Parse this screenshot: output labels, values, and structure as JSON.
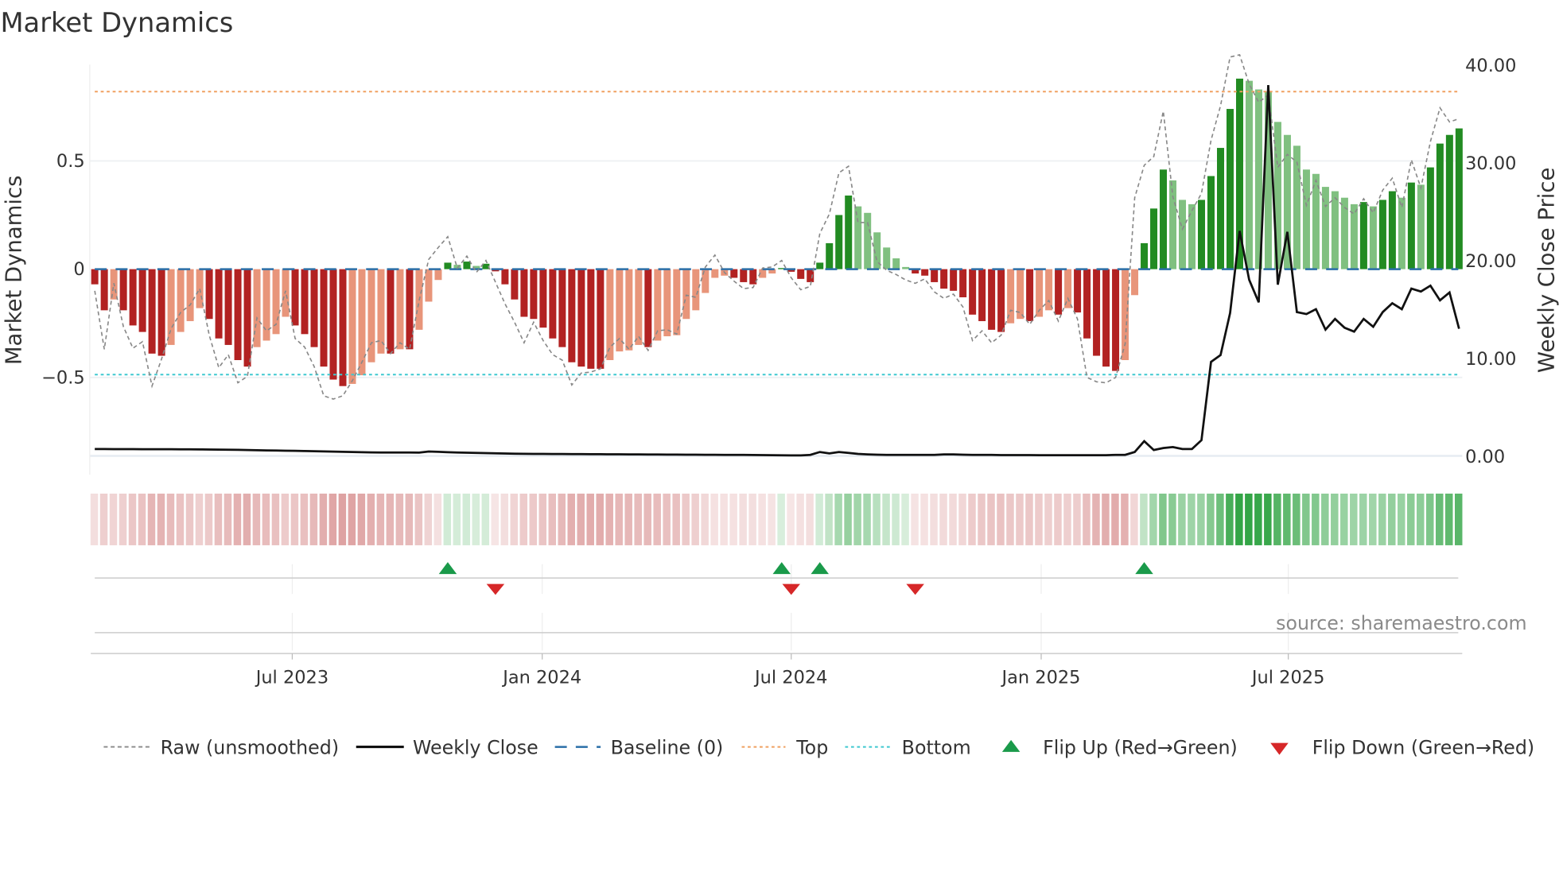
{
  "chart_data": {
    "type": "bar",
    "title": "Market Dynamics",
    "ylabel_left": "Market Dynamics",
    "ylabel_right": "Weekly Close Price",
    "ylim_left": [
      -0.87,
      0.95
    ],
    "ylim_right": [
      0,
      40
    ],
    "yticks_left": [
      {
        "v": 0.5,
        "label": "0.5"
      },
      {
        "v": 0,
        "label": "0"
      },
      {
        "v": -0.5,
        "label": "−0.5"
      }
    ],
    "yticks_right": [
      {
        "v": 40,
        "label": "40.00"
      },
      {
        "v": 30,
        "label": "30.00"
      },
      {
        "v": 20,
        "label": "20.00"
      },
      {
        "v": 10,
        "label": "10.00"
      },
      {
        "v": 0,
        "label": "0.00"
      }
    ],
    "xticks": [
      {
        "week": 20.7,
        "label": "Jul 2023"
      },
      {
        "week": 46.9,
        "label": "Jan 2024"
      },
      {
        "week": 73,
        "label": "Jul 2024"
      },
      {
        "week": 99.2,
        "label": "Jan 2025"
      },
      {
        "week": 125.1,
        "label": "Jul 2025"
      }
    ],
    "top_level": 0.82,
    "bottom_level": -0.487,
    "baseline": 0,
    "smoothed": [
      -0.07,
      -0.19,
      -0.14,
      -0.19,
      -0.26,
      -0.29,
      -0.39,
      -0.4,
      -0.35,
      -0.29,
      -0.24,
      -0.18,
      -0.23,
      -0.32,
      -0.35,
      -0.42,
      -0.45,
      -0.36,
      -0.33,
      -0.3,
      -0.22,
      -0.26,
      -0.3,
      -0.36,
      -0.45,
      -0.51,
      -0.54,
      -0.53,
      -0.49,
      -0.43,
      -0.39,
      -0.39,
      -0.37,
      -0.37,
      -0.28,
      -0.15,
      -0.05,
      0.03,
      0.02,
      0.035,
      0.015,
      0.025,
      -0.01,
      -0.07,
      -0.14,
      -0.22,
      -0.23,
      -0.27,
      -0.32,
      -0.36,
      -0.43,
      -0.45,
      -0.46,
      -0.46,
      -0.42,
      -0.38,
      -0.375,
      -0.35,
      -0.36,
      -0.33,
      -0.31,
      -0.305,
      -0.23,
      -0.19,
      -0.11,
      -0.04,
      -0.03,
      -0.04,
      -0.06,
      -0.07,
      -0.04,
      -0.02,
      0.005,
      -0.012,
      -0.045,
      -0.06,
      0.03,
      0.12,
      0.25,
      0.34,
      0.29,
      0.26,
      0.17,
      0.1,
      0.05,
      0.01,
      -0.02,
      -0.03,
      -0.06,
      -0.09,
      -0.1,
      -0.13,
      -0.21,
      -0.24,
      -0.28,
      -0.29,
      -0.25,
      -0.23,
      -0.24,
      -0.22,
      -0.19,
      -0.21,
      -0.18,
      -0.2,
      -0.32,
      -0.4,
      -0.45,
      -0.47,
      -0.42,
      -0.12,
      0.12,
      0.28,
      0.46,
      0.41,
      0.32,
      0.3,
      0.32,
      0.43,
      0.56,
      0.74,
      0.88,
      0.87,
      0.83,
      0.82,
      0.68,
      0.62,
      0.57,
      0.46,
      0.44,
      0.38,
      0.36,
      0.33,
      0.3,
      0.31,
      0.29,
      0.32,
      0.36,
      0.33,
      0.4,
      0.39,
      0.47,
      0.58,
      0.62,
      0.65
    ],
    "raw": [
      -0.1,
      -0.37,
      -0.065,
      -0.265,
      -0.365,
      -0.335,
      -0.54,
      -0.415,
      -0.275,
      -0.2,
      -0.165,
      -0.09,
      -0.305,
      -0.455,
      -0.395,
      -0.525,
      -0.495,
      -0.225,
      -0.285,
      -0.255,
      -0.1,
      -0.32,
      -0.36,
      -0.45,
      -0.585,
      -0.6,
      -0.585,
      -0.515,
      -0.43,
      -0.34,
      -0.33,
      -0.39,
      -0.34,
      -0.37,
      -0.145,
      0.045,
      0.1,
      0.15,
      0.005,
      0.06,
      -0.015,
      0.04,
      -0.06,
      -0.16,
      -0.245,
      -0.34,
      -0.245,
      -0.33,
      -0.395,
      -0.42,
      -0.535,
      -0.48,
      -0.475,
      -0.46,
      -0.36,
      -0.32,
      -0.37,
      -0.31,
      -0.375,
      -0.285,
      -0.28,
      -0.3,
      -0.12,
      -0.13,
      0.01,
      0.065,
      -0.015,
      -0.055,
      -0.09,
      -0.085,
      0.005,
      0.01,
      0.04,
      -0.04,
      -0.095,
      -0.08,
      0.165,
      0.255,
      0.445,
      0.475,
      0.215,
      0.215,
      0.035,
      -0.005,
      -0.025,
      -0.05,
      -0.065,
      -0.045,
      -0.105,
      -0.135,
      -0.115,
      -0.175,
      -0.33,
      -0.285,
      -0.34,
      -0.305,
      -0.19,
      -0.2,
      -0.255,
      -0.19,
      -0.145,
      -0.24,
      -0.135,
      -0.23,
      -0.5,
      -0.52,
      -0.525,
      -0.5,
      -0.345,
      0.33,
      0.48,
      0.52,
      0.73,
      0.335,
      0.185,
      0.27,
      0.35,
      0.595,
      0.755,
      0.98,
      0.99,
      0.855,
      0.77,
      0.805,
      0.47,
      0.53,
      0.495,
      0.295,
      0.41,
      0.29,
      0.33,
      0.285,
      0.255,
      0.325,
      0.26,
      0.365,
      0.42,
      0.285,
      0.505,
      0.375,
      0.59,
      0.745,
      0.68,
      0.695
    ],
    "weekly_close": [
      0.7,
      0.7,
      0.69,
      0.69,
      0.69,
      0.68,
      0.68,
      0.68,
      0.68,
      0.67,
      0.67,
      0.66,
      0.65,
      0.64,
      0.63,
      0.62,
      0.6,
      0.58,
      0.56,
      0.55,
      0.53,
      0.52,
      0.5,
      0.48,
      0.46,
      0.44,
      0.42,
      0.4,
      0.38,
      0.36,
      0.35,
      0.35,
      0.35,
      0.35,
      0.34,
      0.45,
      0.42,
      0.38,
      0.35,
      0.32,
      0.3,
      0.28,
      0.26,
      0.24,
      0.22,
      0.21,
      0.2,
      0.2,
      0.19,
      0.19,
      0.18,
      0.18,
      0.17,
      0.17,
      0.16,
      0.16,
      0.15,
      0.15,
      0.14,
      0.14,
      0.13,
      0.13,
      0.12,
      0.12,
      0.11,
      0.11,
      0.1,
      0.1,
      0.1,
      0.09,
      0.08,
      0.07,
      0.06,
      0.05,
      0.05,
      0.1,
      0.4,
      0.25,
      0.4,
      0.3,
      0.2,
      0.15,
      0.12,
      0.1,
      0.1,
      0.1,
      0.1,
      0.1,
      0.1,
      0.15,
      0.15,
      0.12,
      0.1,
      0.1,
      0.1,
      0.08,
      0.08,
      0.08,
      0.08,
      0.07,
      0.07,
      0.07,
      0.07,
      0.07,
      0.07,
      0.07,
      0.07,
      0.1,
      0.1,
      0.4,
      1.5,
      0.6,
      0.8,
      0.9,
      0.7,
      0.7,
      1.6,
      9.6,
      10.3,
      14.6,
      23.0,
      18.0,
      15.7,
      37.9,
      17.5,
      22.9,
      14.7,
      14.5,
      15.0,
      12.9,
      14.0,
      13.1,
      12.7,
      14.0,
      13.2,
      14.7,
      15.6,
      15.0,
      17.1,
      16.8,
      17.4,
      15.9,
      16.7,
      13.0
    ],
    "legend": [
      {
        "label": "Raw (unsmoothed)"
      },
      {
        "label": "Weekly Close"
      },
      {
        "label": "Baseline (0)"
      },
      {
        "label": "Top"
      },
      {
        "label": "Bottom"
      },
      {
        "label": "Flip Up (Red→Green)"
      },
      {
        "label": "Flip Down (Green→Red)"
      }
    ],
    "legend_placement": "bottom",
    "source": "source: sharemaestro.com",
    "colors": {
      "neg_strong": "#b22222",
      "neg_weak": "#e8957a",
      "pos_strong": "#228b22",
      "pos_weak": "#80c080",
      "raw": "#888888",
      "close": "#111111",
      "baseline": "#2a6fa8",
      "top": "#f0a060",
      "bottom": "#3ec8d0",
      "flip_up": "#1a9a4a",
      "flip_down": "#d62728"
    }
  }
}
